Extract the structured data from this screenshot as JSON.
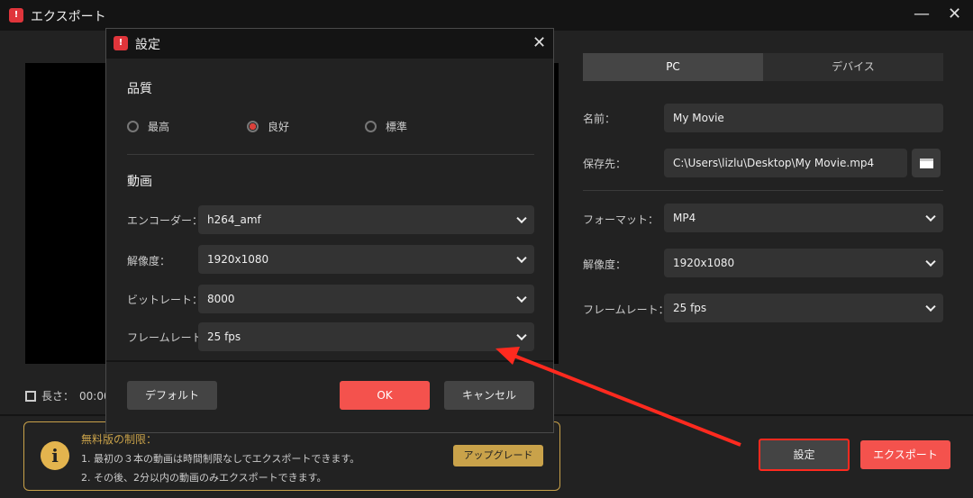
{
  "window": {
    "title": "エクスポート",
    "minimize": "—",
    "close": "✕"
  },
  "preview": {
    "length_label": "長さ：",
    "length_value": "00:00:"
  },
  "notice": {
    "title": "無料版の制限：",
    "line1": "1.  最初の３本の動画は時間制限なしでエクスポートできます。",
    "line2": "2.  その後、2分以内の動画のみエクスポートできます。",
    "upgrade": "アップグレード",
    "icon": "info-icon"
  },
  "dialog": {
    "title": "設定",
    "close": "✕",
    "quality": {
      "heading": "品質",
      "options": [
        "最高",
        "良好",
        "標準"
      ],
      "selected": "良好"
    },
    "video": {
      "heading": "動画",
      "rows": [
        {
          "label": "エンコーダー：",
          "value": "h264_amf"
        },
        {
          "label": "解像度：",
          "value": "1920x1080"
        },
        {
          "label": "ビットレート：",
          "value": "8000"
        },
        {
          "label": "フレームレート：",
          "value": "25 fps"
        }
      ]
    },
    "buttons": {
      "default": "デフォルト",
      "ok": "OK",
      "cancel": "キャンセル"
    }
  },
  "right": {
    "tabs": [
      "PC",
      "デバイス"
    ],
    "active_tab": "PC",
    "name_label": "名前：",
    "name_value": "My Movie",
    "path_label": "保存先：",
    "path_value": "C:\\Users\\lizlu\\Desktop\\My Movie.mp4",
    "format_label": "フォーマット：",
    "format_value": "MP4",
    "resolution_label": "解像度：",
    "resolution_value": "1920x1080",
    "framerate_label": "フレームレート：",
    "framerate_value": "25 fps"
  },
  "footer": {
    "settings": "設定",
    "export": "エクスポート"
  },
  "colors": {
    "accent": "#f4524d",
    "gold": "#c9a24a",
    "annotation": "#ff2a1f"
  }
}
